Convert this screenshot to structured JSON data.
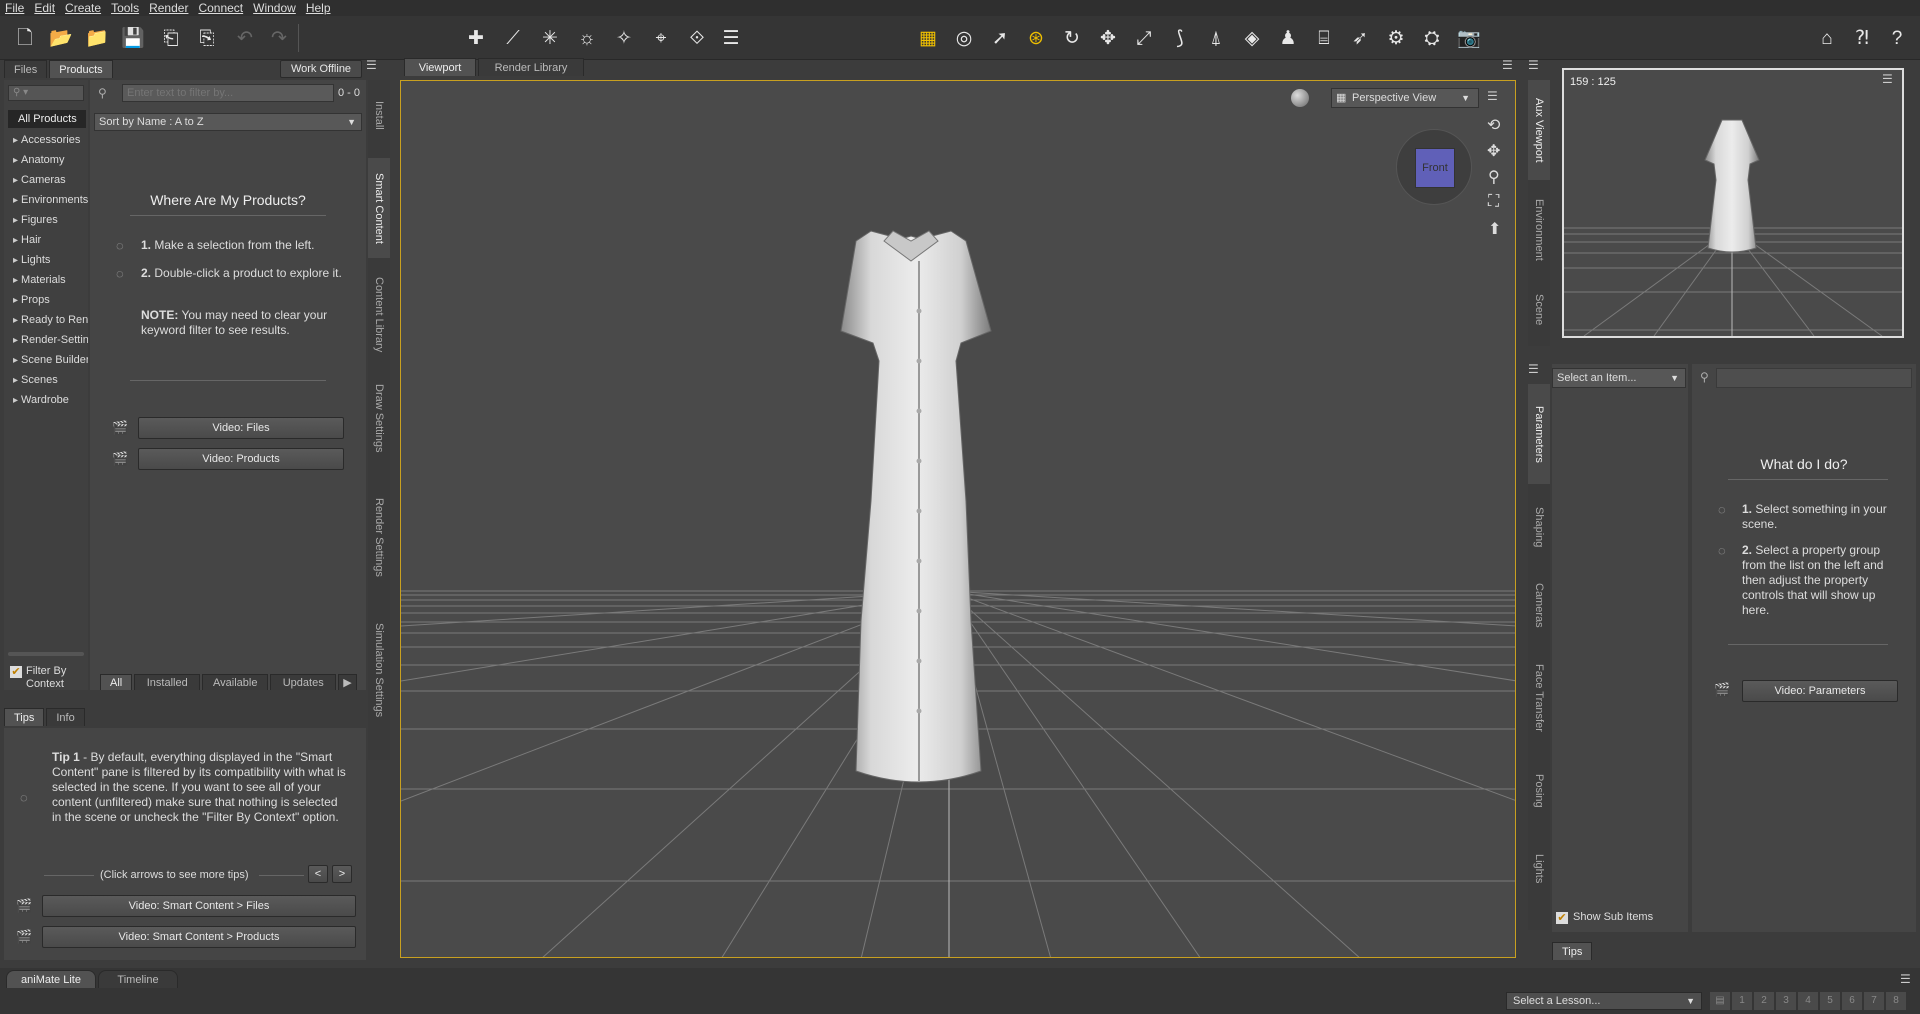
{
  "menu": [
    "File",
    "Edit",
    "Create",
    "Tools",
    "Render",
    "Connect",
    "Window",
    "Help"
  ],
  "left": {
    "top_tabs": [
      "Files",
      "Products"
    ],
    "work_offline": "Work Offline",
    "filter_placeholder": "Enter text to filter by...",
    "count": "0 - 0",
    "sort": "Sort by Name : A to Z",
    "all_products": "All Products",
    "categories": [
      "Accessories",
      "Anatomy",
      "Cameras",
      "Environments",
      "Figures",
      "Hair",
      "Lights",
      "Materials",
      "Props",
      "Ready to Render",
      "Render-Settings",
      "Scene Builder",
      "Scenes",
      "Wardrobe"
    ],
    "where_title": "Where Are My Products?",
    "step1_num": "1.",
    "step1": "Make a selection from the left.",
    "step2_num": "2.",
    "step2": "Double-click a product to explore it.",
    "note_label": "NOTE:",
    "note": "You may need to clear your keyword filter to see results.",
    "video_files": "Video: Files",
    "video_products": "Video: Products",
    "filter_by_context": "Filter By Context",
    "bottom_tabs": [
      "All",
      "Installed",
      "Available",
      "Updates"
    ],
    "vtabs": [
      "Install",
      "Smart Content",
      "Content Library",
      "Draw Settings",
      "Render Settings",
      "Simulation Settings"
    ]
  },
  "tips": {
    "tabs": [
      "Tips",
      "Info"
    ],
    "tip_label": "Tip 1",
    "tip_text": " - By default, everything displayed in the \"Smart Content\" pane is filtered by its compatibility with what is selected in the scene. If you want to see all of your content (unfiltered) make sure that nothing is selected in the scene or uncheck the \"Filter By Context\" option.",
    "nav_hint": "(Click arrows to see more tips)",
    "prev": "<",
    "next": ">",
    "video1": "Video: Smart Content > Files",
    "video2": "Video: Smart Content > Products"
  },
  "viewport": {
    "tabs": [
      "Viewport",
      "Render Library"
    ],
    "view_label": "Perspective View",
    "cube_label": "Front"
  },
  "aux": {
    "coord": "159 : 125",
    "vtabs": [
      "Aux Viewport",
      "Environment",
      "Scene"
    ]
  },
  "params": {
    "select": "Select an Item...",
    "title": "What do I do?",
    "step1_num": "1.",
    "step1": "Select something in your scene.",
    "step2_num": "2.",
    "step2": "Select a property group from the list on the left and then adjust the property controls that will show up here.",
    "video": "Video: Parameters",
    "show_sub": "Show Sub Items",
    "tips_tab": "Tips",
    "vtabs": [
      "Parameters",
      "Shaping",
      "Cameras",
      "Face Transfer",
      "Posing",
      "Lights"
    ]
  },
  "bottom": {
    "tabs": [
      "aniMate Lite",
      "Timeline"
    ],
    "lesson": "Select a Lesson...",
    "pages": [
      "1",
      "2",
      "3",
      "4",
      "5",
      "6",
      "7",
      "8"
    ]
  }
}
